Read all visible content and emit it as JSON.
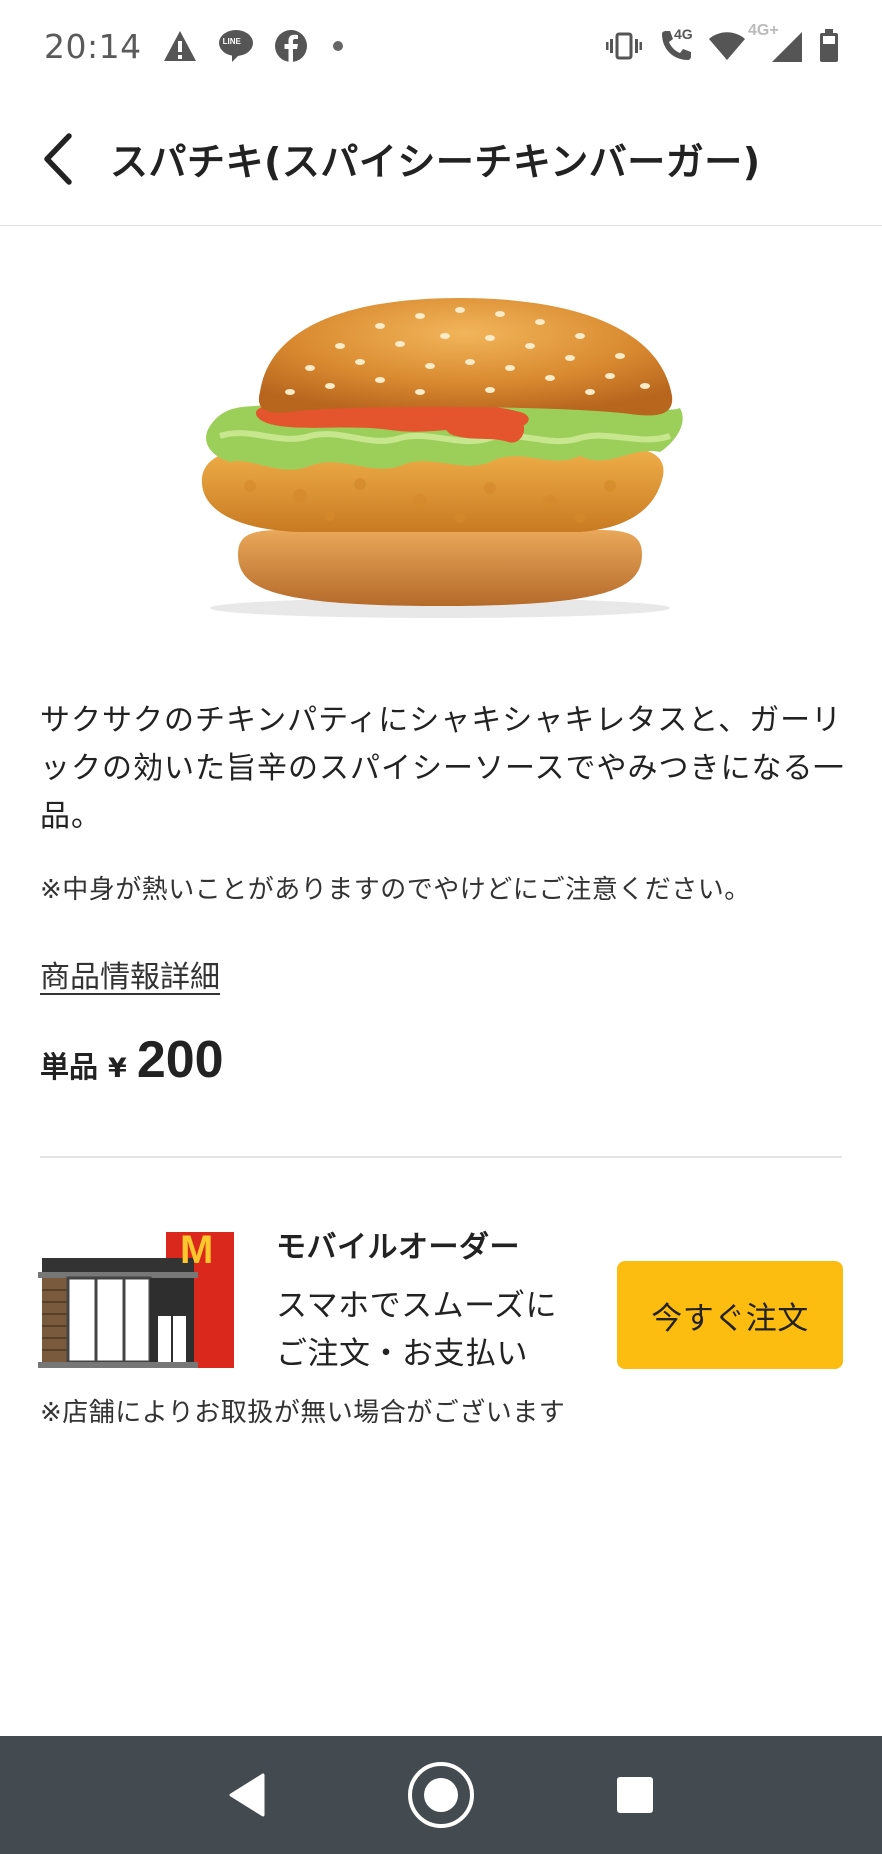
{
  "status_bar": {
    "time": "20:14",
    "left_icons": [
      "warning-icon",
      "line-icon",
      "facebook-icon",
      "dot-icon"
    ],
    "line_badge": "LINE",
    "network_4g": "4G",
    "network_4g_plus": "4G+",
    "right_icons": [
      "vibrate-icon",
      "volte-call-icon",
      "wifi-icon",
      "signal-icon",
      "battery-icon"
    ]
  },
  "header": {
    "back_icon": "chevron-left-icon",
    "title": "スパチキ(スパイシーチキンバーガー)"
  },
  "product": {
    "image": "spicy-chicken-burger-image",
    "description": "サクサクのチキンパティにシャキシャキレタスと、ガーリックの効いた旨辛のスパイシーソースでやみつきになる一品。",
    "caution": "※中身が熱いことがありますのでやけどにご注意ください。",
    "detail_link": "商品情報詳細",
    "price_unit": "単品",
    "price_currency": "¥",
    "price_value": "200"
  },
  "mobile_order": {
    "icon": "mcdonalds-store-icon",
    "logo_letter": "M",
    "title": "モバイルオーダー",
    "desc_line1": "スマホでスムーズに",
    "desc_line2": "ご注文・お支払い",
    "button_label": "今すぐ注文",
    "note": "※店舗によりお取扱が無い場合がございます",
    "button_color": "#fdbd10"
  },
  "nav_bar": {
    "buttons": [
      "back-triangle-icon",
      "home-circle-icon",
      "recents-square-icon"
    ],
    "background": "#434a50"
  }
}
